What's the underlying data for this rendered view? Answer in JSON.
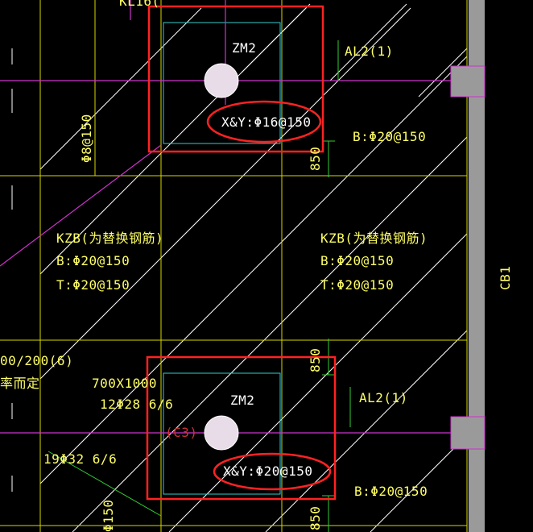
{
  "labels": {
    "kl_top": "KL16(",
    "zm2_top": "ZM2",
    "al2_top": "AL2(1)",
    "xy_top": "X&Y:Φ16@150",
    "b_top": "B:Φ20@150",
    "phi8_150": "Φ8@150",
    "dim_850_top": "850",
    "kzb_left": "KZB(为替换钢筋)",
    "b_left": "B:Φ20@150",
    "t_left": "T:Φ20@150",
    "kzb_right": "KZB(为替换钢筋)",
    "b_right": "B:Φ20@150",
    "t_right": "T:Φ20@150",
    "cb1": "CB1",
    "stirrup_left": "00/200(6)",
    "rate_left": "率而定",
    "size_700": "700X1000",
    "bars_12": "12Φ28 6/6",
    "zm2_bottom": "ZM2",
    "c3": "(C3)",
    "al2_bottom": "AL2(1)",
    "dim_850_mid": "850",
    "bars_19": "19Φ32 6/6",
    "xy_bottom": "X&Y:Φ20@150",
    "b_bottom": "B:Φ20@150",
    "dim_850_bottom": "850",
    "phi_150_bottom": "Φ150"
  },
  "colors": {
    "background": "#000000",
    "text": "#ffff66",
    "highlight_box": "#ff2222",
    "cyan": "#33cccc",
    "magenta": "#cc33cc",
    "green": "#33cc33",
    "gray_wall": "#909090"
  }
}
